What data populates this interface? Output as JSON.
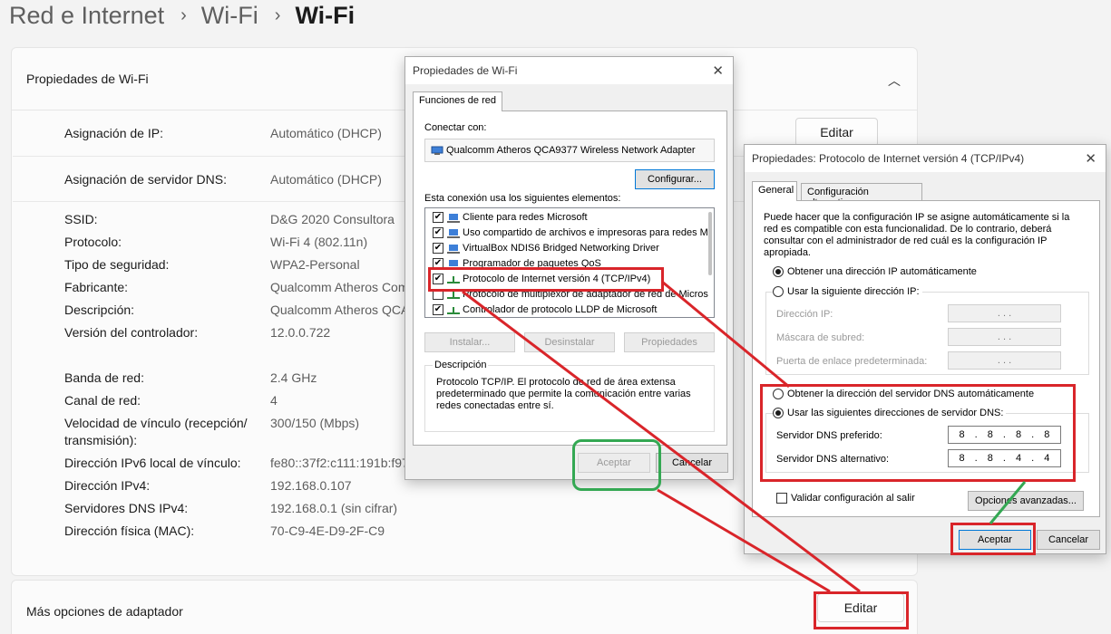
{
  "breadcrumb": {
    "items": [
      "Red e Internet",
      "Wi-Fi"
    ],
    "current": "Wi-Fi",
    "separator": "›"
  },
  "properties_card": {
    "title": "Propiedades de Wi-Fi",
    "ip_assignment": {
      "label": "Asignación de IP:",
      "value": "Automático (DHCP)",
      "edit": "Editar"
    },
    "dns_assignment": {
      "label": "Asignación de servidor DNS:",
      "value": "Automático (DHCP)"
    },
    "details": [
      {
        "label": "SSID:",
        "value": "D&G 2020 Consultora"
      },
      {
        "label": "Protocolo:",
        "value": "Wi-Fi 4 (802.11n)"
      },
      {
        "label": "Tipo de seguridad:",
        "value": "WPA2-Personal"
      },
      {
        "label": "Fabricante:",
        "value": "Qualcomm Atheros Com"
      },
      {
        "label": "Descripción:",
        "value": "Qualcomm Atheros QCA"
      },
      {
        "label": "Versión del controlador:",
        "value": "12.0.0.722"
      },
      {
        "label": "Banda de red:",
        "value": "2.4 GHz"
      },
      {
        "label": "Canal de red:",
        "value": "4"
      },
      {
        "label": "Velocidad de vínculo (recepción/",
        "label2": "transmisión):",
        "value": "300/150 (Mbps)"
      },
      {
        "label": "Dirección IPv6 local de vínculo:",
        "value": "fe80::37f2:c111:191b:f97%"
      },
      {
        "label": "Dirección IPv4:",
        "value": "192.168.0.107"
      },
      {
        "label": "Servidores DNS IPv4:",
        "value": "192.168.0.1 (sin cifrar)"
      },
      {
        "label": "Dirección física (MAC):",
        "value": "70-C9-4E-D9-2F-C9"
      }
    ]
  },
  "more_card": {
    "title": "Más opciones de adaptador",
    "edit": "Editar"
  },
  "wifi_dialog": {
    "title": "Propiedades de Wi-Fi",
    "tab": "Funciones de red",
    "connect_label": "Conectar con:",
    "adapter": "Qualcomm Atheros QCA9377 Wireless Network Adapter",
    "configure": "Configurar...",
    "items_label": "Esta conexión usa los siguientes elementos:",
    "items": [
      {
        "label": "Cliente para redes Microsoft",
        "checked": true
      },
      {
        "label": "Uso compartido de archivos e impresoras para redes M",
        "checked": true
      },
      {
        "label": "VirtualBox NDIS6 Bridged Networking Driver",
        "checked": true
      },
      {
        "label": "Programador de paquetes QoS",
        "checked": true
      },
      {
        "label": "Protocolo de Internet versión 4 (TCP/IPv4)",
        "checked": true
      },
      {
        "label": "Protocolo de multiplexor de adaptador de red de Micros",
        "checked": false
      },
      {
        "label": "Controlador de protocolo LLDP de Microsoft",
        "checked": true
      }
    ],
    "install": "Instalar...",
    "uninstall": "Desinstalar",
    "properties": "Propiedades",
    "description_title": "Descripción",
    "description": [
      "Protocolo TCP/IP. El protocolo de red de área extensa",
      "predeterminado que permite la comunicación entre varias",
      "redes conectadas entre sí."
    ],
    "ok": "Aceptar",
    "cancel": "Cancelar"
  },
  "ipv4_dialog": {
    "title": "Propiedades: Protocolo de Internet versión 4 (TCP/IPv4)",
    "tabs": [
      "General",
      "Configuración alternativa"
    ],
    "intro": [
      "Puede hacer que la configuración IP se asigne automáticamente si la",
      "red es compatible con esta funcionalidad. De lo contrario, deberá",
      "consultar con el administrador de red cuál es la configuración IP",
      "apropiada."
    ],
    "auto_ip": "Obtener una dirección IP automáticamente",
    "manual_ip": "Usar la siguiente dirección IP:",
    "ip_address": "Dirección IP:",
    "subnet": "Máscara de subred:",
    "gateway": "Puerta de enlace predeterminada:",
    "empty_ip": ". . .",
    "auto_dns": "Obtener la dirección del servidor DNS automáticamente",
    "manual_dns": "Usar las siguientes direcciones de servidor DNS:",
    "preferred_dns_label": "Servidor DNS preferido:",
    "preferred_dns": [
      "8",
      "8",
      "8",
      "8"
    ],
    "alternate_dns_label": "Servidor DNS alternativo:",
    "alternate_dns": [
      "8",
      "8",
      "4",
      "4"
    ],
    "validate": "Validar configuración al salir",
    "advanced": "Opciones avanzadas...",
    "ok": "Aceptar",
    "cancel": "Cancelar"
  },
  "annotation_colors": {
    "red": "#d9252a",
    "green": "#34a853"
  }
}
